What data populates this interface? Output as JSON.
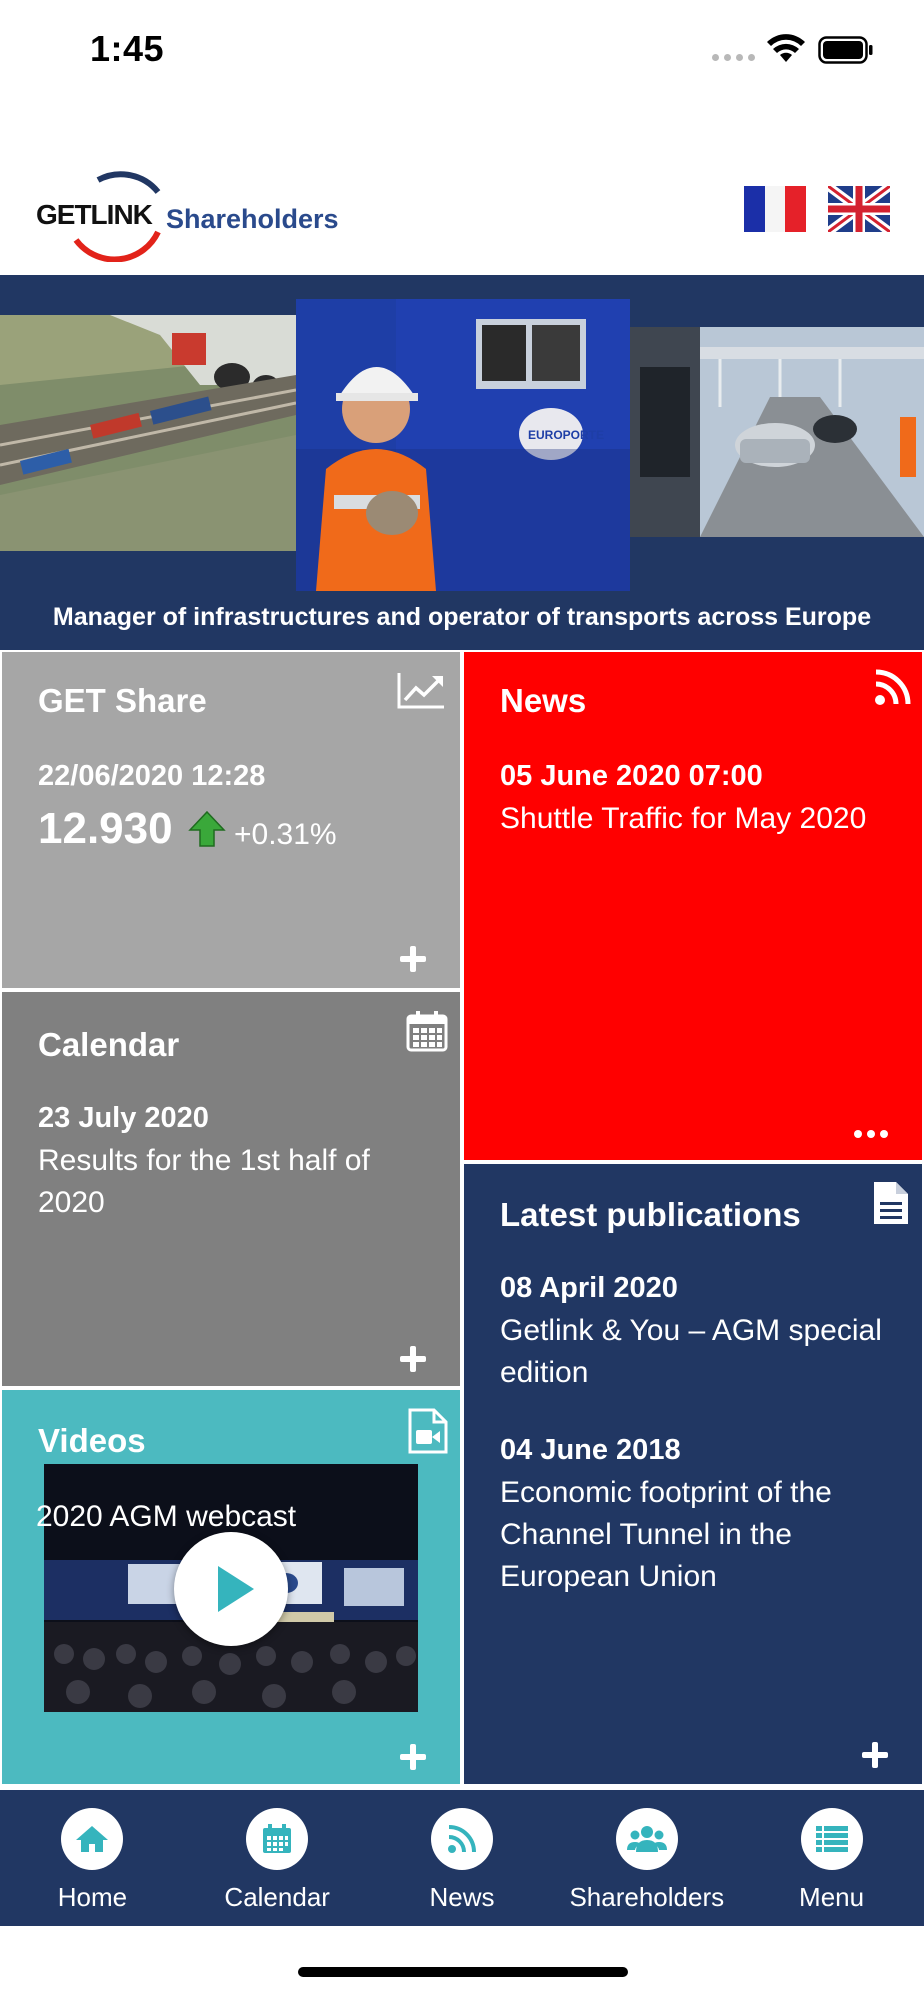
{
  "status_bar": {
    "time": "1:45"
  },
  "header": {
    "logo_brand": "GETLINK",
    "logo_sub": "Shareholders",
    "flags": [
      "french-flag",
      "uk-flag"
    ]
  },
  "banner": {
    "tagline": "Manager of infrastructures and operator of transports across Europe"
  },
  "tiles": {
    "share": {
      "title": "GET Share",
      "timestamp": "22/06/2020 12:28",
      "price": "12.930",
      "change": "+0.31%",
      "icon": "chart-line-icon"
    },
    "news": {
      "title": "News",
      "date": "05 June 2020 07:00",
      "headline": "Shuttle Traffic for May 2020",
      "icon": "rss-icon"
    },
    "calendar": {
      "title": "Calendar",
      "date": "23 July 2020",
      "event": "Results for the 1st half of 2020",
      "icon": "calendar-icon"
    },
    "publications": {
      "title": "Latest publications",
      "icon": "document-icon",
      "items": [
        {
          "date": "08 April 2020",
          "title": "Getlink & You – AGM special edition"
        },
        {
          "date": "04 June 2018",
          "title": "Economic footprint of the Channel Tunnel in the European Union"
        }
      ]
    },
    "videos": {
      "title": "Videos",
      "video_title": "2020 AGM webcast",
      "icon": "video-file-icon"
    }
  },
  "bottom_nav": {
    "items": [
      {
        "label": "Home",
        "icon": "home-icon"
      },
      {
        "label": "Calendar",
        "icon": "calendar-icon"
      },
      {
        "label": "News",
        "icon": "rss-icon"
      },
      {
        "label": "Shareholders",
        "icon": "users-icon"
      },
      {
        "label": "Menu",
        "icon": "list-icon"
      }
    ]
  },
  "colors": {
    "navy": "#213763",
    "share_grey": "#a6a6a6",
    "calendar_grey": "#808080",
    "news_red": "#ff0000",
    "videos_teal": "#4cbac0",
    "nav_icon": "#35b4bd",
    "arrow_green": "#3aa83a"
  }
}
